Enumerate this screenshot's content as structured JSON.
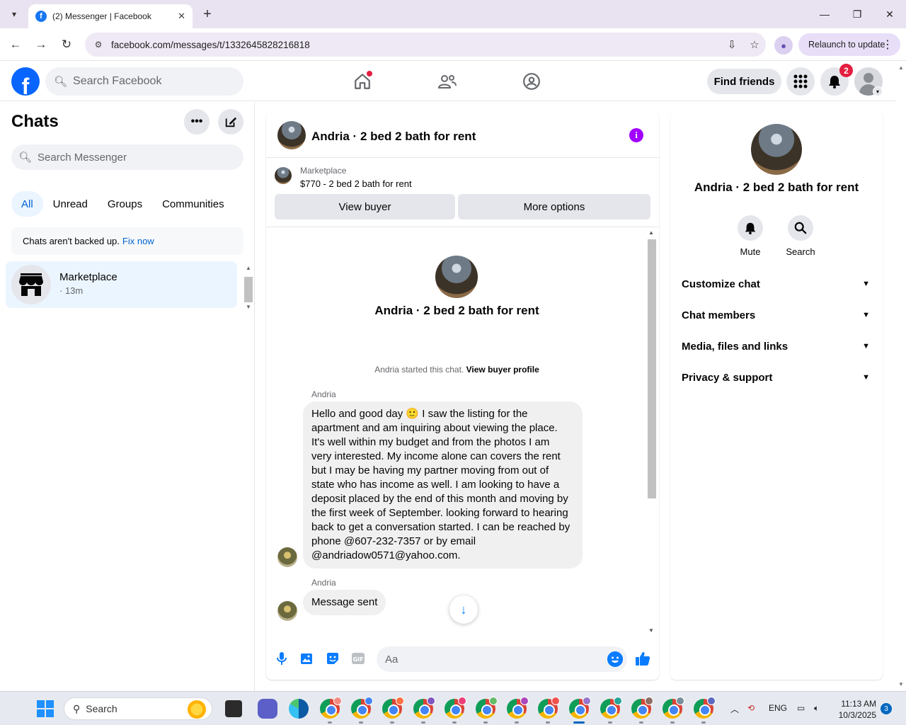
{
  "browser": {
    "tab_title": "(2) Messenger | Facebook",
    "url": "facebook.com/messages/t/1332645828216818",
    "relaunch_label": "Relaunch to update"
  },
  "fb_header": {
    "search_placeholder": "Search Facebook",
    "find_friends_label": "Find friends",
    "notification_count": "2"
  },
  "left_panel": {
    "title": "Chats",
    "search_placeholder": "Search Messenger",
    "filters": [
      "All",
      "Unread",
      "Groups",
      "Communities"
    ],
    "active_filter": "All",
    "backup_text": "Chats aren't backed up.",
    "backup_link": "Fix now",
    "chats": [
      {
        "name": "Marketplace",
        "time": "· 13m"
      }
    ]
  },
  "conversation": {
    "title": "Andria · 2 bed 2 bath for rent",
    "marketplace_label": "Marketplace",
    "listing": "$770 - 2 bed 2 bath for rent",
    "view_buyer_label": "View buyer",
    "more_options_label": "More options",
    "intro_name": "Andria · 2 bed 2 bath for rent",
    "started_text": "Andria started this chat.",
    "view_buyer_profile": "View buyer profile",
    "messages": [
      {
        "sender": "Andria",
        "lines": [
          "Hello and good day 🙂 I saw the listing for the",
          "apartment and am inquiring about viewing the place.",
          "It's well within my budget and from the photos I am",
          "very interested. My income alone can covers the rent",
          "but I may be having my partner moving from out of",
          "state who has income as well. I am looking to have a",
          "deposit placed by the end of this month and moving by",
          "the first week of September. looking forward to hearing",
          "back to get a conversation started. I can be reached by",
          "phone @607-232-7357 or by email",
          "@andriadow0571@yahoo.com."
        ]
      },
      {
        "sender": "Andria",
        "lines": [
          "Message sent"
        ]
      }
    ],
    "composer_placeholder": "Aa"
  },
  "details": {
    "name": "Andria · 2 bed 2 bath for rent",
    "mute_label": "Mute",
    "search_label": "Search",
    "sections": [
      "Customize chat",
      "Chat members",
      "Media, files and links",
      "Privacy & support"
    ]
  },
  "taskbar": {
    "search_label": "Search",
    "language": "ENG",
    "time": "11:13 AM",
    "date": "10/3/2025",
    "notification_count": "3"
  },
  "colors": {
    "facebook_blue": "#0866ff",
    "messenger_blue": "#0a7cff",
    "info_purple": "#a100ff",
    "badge_red": "#e41e3f"
  }
}
